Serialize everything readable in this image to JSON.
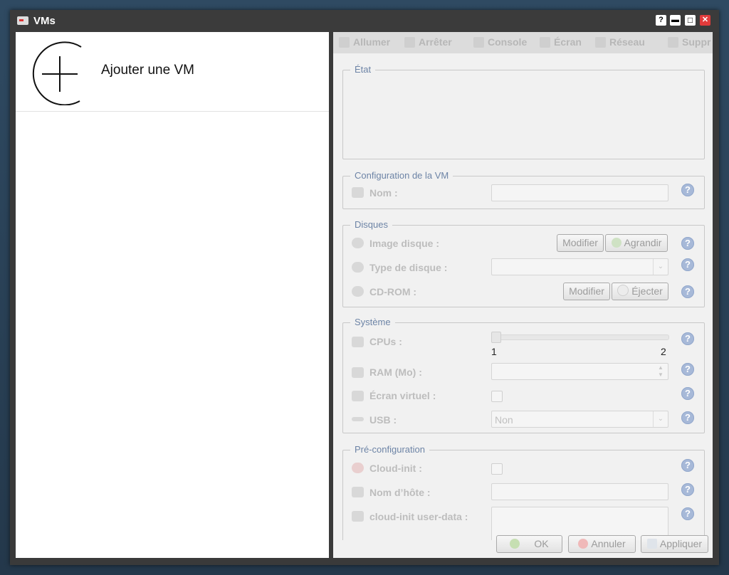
{
  "window": {
    "title": "VMs"
  },
  "titlebar_buttons": {
    "help": "?",
    "minimize": "▬",
    "maximize": "□",
    "close": "✕"
  },
  "left": {
    "add_vm_label": "Ajouter une VM"
  },
  "toolbar": {
    "items": [
      "Allumer",
      "Arrêter",
      "Console",
      "Écran",
      "Réseau",
      "Suppr"
    ]
  },
  "state_group": {
    "legend": "État"
  },
  "config_group": {
    "legend": "Configuration de la VM",
    "name_label": "Nom :",
    "name_value": ""
  },
  "disks_group": {
    "legend": "Disques",
    "image_label": "Image disque :",
    "modify_label": "Modifier",
    "enlarge_label": "Agrandir",
    "type_label": "Type de disque :",
    "type_value": "",
    "cdrom_label": "CD-ROM :",
    "cdrom_modify_label": "Modifier",
    "eject_label": "Éjecter"
  },
  "system_group": {
    "legend": "Système",
    "cpus_label": "CPUs :",
    "cpus_min": "1",
    "cpus_max": "2",
    "cpus_value": 1,
    "ram_label": "RAM (Mo) :",
    "ram_value": "",
    "screen_label": "Écran virtuel :",
    "screen_checked": false,
    "usb_label": "USB :",
    "usb_value": "Non"
  },
  "preconfig_group": {
    "legend": "Pré-configuration",
    "cloudinit_label": "Cloud-init :",
    "cloudinit_checked": false,
    "hostname_label": "Nom d’hôte :",
    "hostname_value": "",
    "userdata_label": "cloud-init user-data :"
  },
  "help_glyph": "?",
  "footer": {
    "ok": "OK",
    "cancel": "Annuler",
    "apply": "Appliquer"
  },
  "colors": {
    "accent_legend": "#6d84a6",
    "help_icon": "#a7b9d8",
    "close_button": "#e23b3b"
  }
}
